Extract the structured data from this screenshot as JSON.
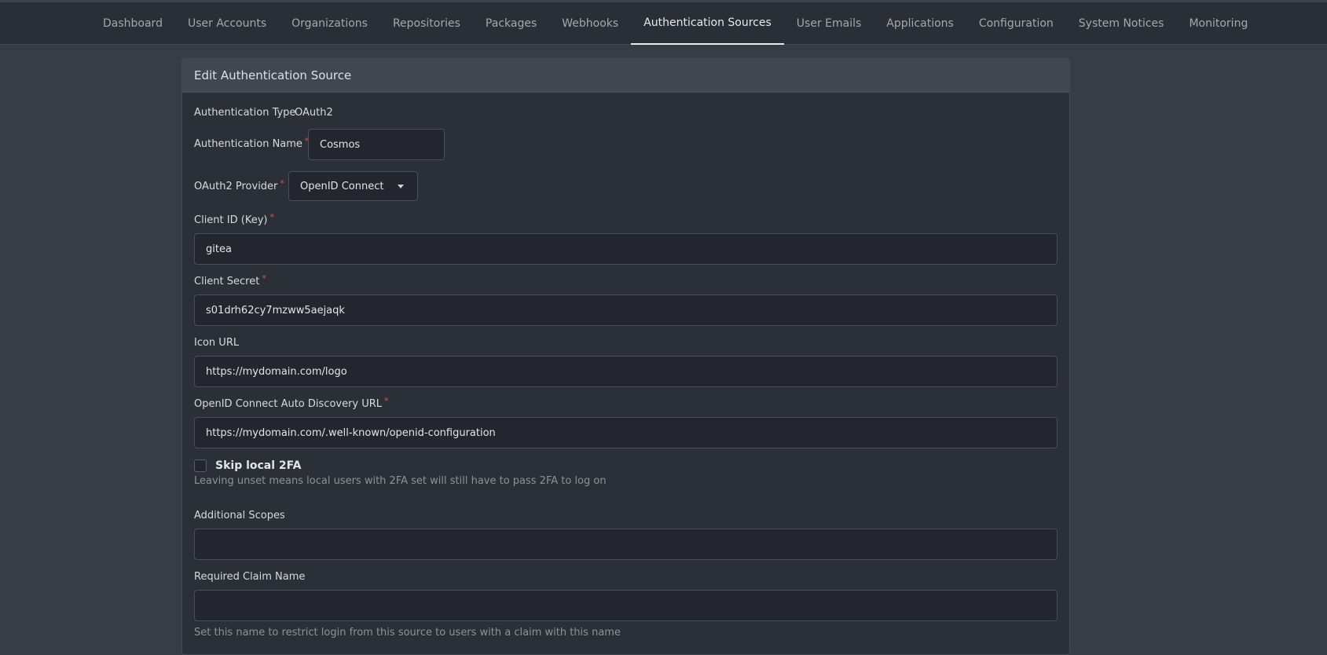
{
  "nav": {
    "tabs": [
      {
        "label": "Dashboard"
      },
      {
        "label": "User Accounts"
      },
      {
        "label": "Organizations"
      },
      {
        "label": "Repositories"
      },
      {
        "label": "Packages"
      },
      {
        "label": "Webhooks"
      },
      {
        "label": "Authentication Sources"
      },
      {
        "label": "User Emails"
      },
      {
        "label": "Applications"
      },
      {
        "label": "Configuration"
      },
      {
        "label": "System Notices"
      },
      {
        "label": "Monitoring"
      }
    ],
    "active_tab": "Authentication Sources"
  },
  "form": {
    "title": "Edit Authentication Source",
    "auth_type_label": "Authentication Type",
    "auth_type_value": "OAuth2",
    "auth_name_label": "Authentication Name",
    "auth_name_value": "Cosmos",
    "provider_label": "OAuth2 Provider",
    "provider_value": "OpenID Connect",
    "client_id_label": "Client ID (Key)",
    "client_id_value": "gitea",
    "client_secret_label": "Client Secret",
    "client_secret_value": "s01drh62cy7mzww5aejaqk",
    "icon_url_label": "Icon URL",
    "icon_url_value": "https://mydomain.com/logo",
    "discovery_url_label": "OpenID Connect Auto Discovery URL",
    "discovery_url_value": "https://mydomain.com/.well-known/openid-configuration",
    "skip_2fa_label": "Skip local 2FA",
    "skip_2fa_checked": false,
    "skip_2fa_help": "Leaving unset means local users with 2FA set will still have to pass 2FA to log on",
    "scopes_label": "Additional Scopes",
    "scopes_value": "",
    "claim_name_label": "Required Claim Name",
    "claim_name_value": "",
    "claim_name_help": "Set this name to restrict login from this source to users with a claim with this name",
    "required_marker": "*"
  }
}
